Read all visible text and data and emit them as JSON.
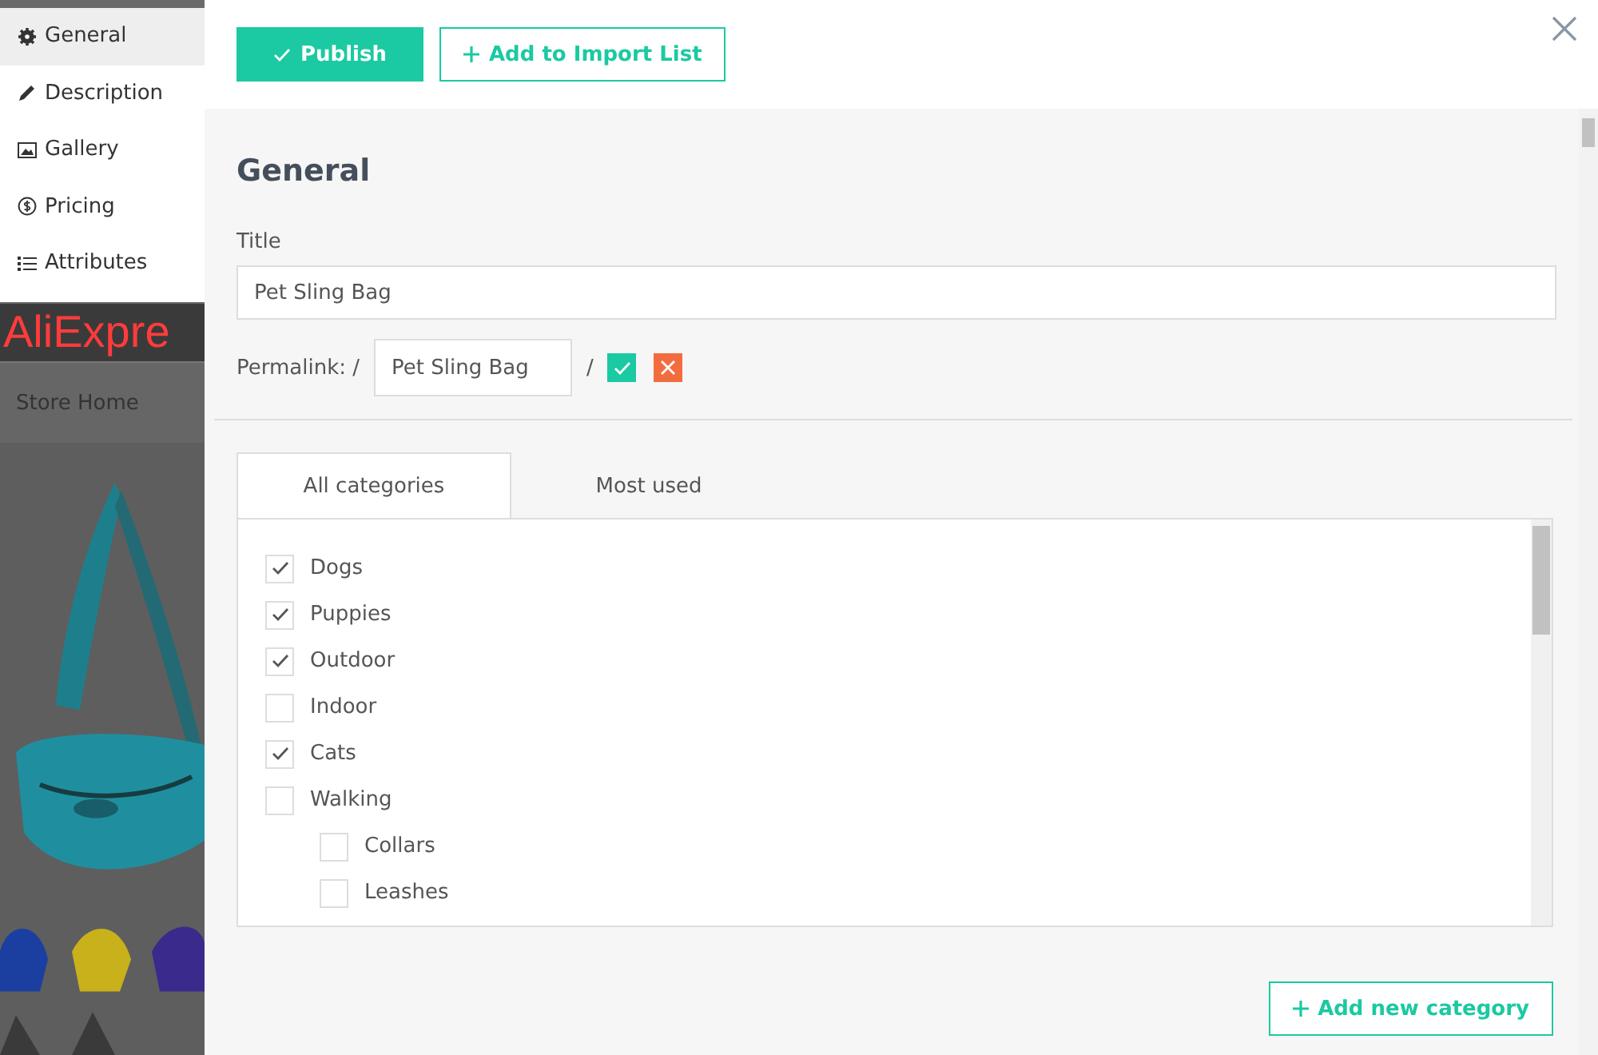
{
  "background_page": {
    "logo": "AliExpre",
    "nav": [
      "Store Home"
    ],
    "picture": {
      "kind": "picture"
    }
  },
  "sidebar": {
    "items": [
      {
        "label": "General",
        "selected": true
      },
      {
        "label": "Description",
        "selected": false
      },
      {
        "label": "Gallery",
        "selected": false
      },
      {
        "label": "Pricing",
        "selected": false
      },
      {
        "label": "Attributes",
        "selected": false
      }
    ]
  },
  "toolbar": {
    "buttons": [
      {
        "label": "Publish",
        "kind": "primary"
      },
      {
        "label": "Add to Import List",
        "kind": "outline"
      }
    ]
  },
  "section": {
    "heading": "General",
    "title_label": "Title",
    "title_value": "Pet Sling Bag",
    "permalink_label": "Permalink: /",
    "permalink_value": "Pet Sling Bag",
    "permalink_suffix": "/"
  },
  "category_tabs": [
    {
      "label": "All categories",
      "selected": true
    },
    {
      "label": "Most used",
      "selected": false
    }
  ],
  "categories": [
    {
      "label": "Dogs",
      "checked": true
    },
    {
      "label": "Puppies",
      "checked": true
    },
    {
      "label": "Outdoor",
      "checked": true
    },
    {
      "label": "Indoor",
      "checked": false
    },
    {
      "label": "Cats",
      "checked": true
    },
    {
      "label": "Walking",
      "checked": false,
      "children": [
        {
          "label": "Collars",
          "checked": false
        },
        {
          "label": "Leashes",
          "checked": false
        }
      ]
    }
  ],
  "add_category_button": "Add new category"
}
